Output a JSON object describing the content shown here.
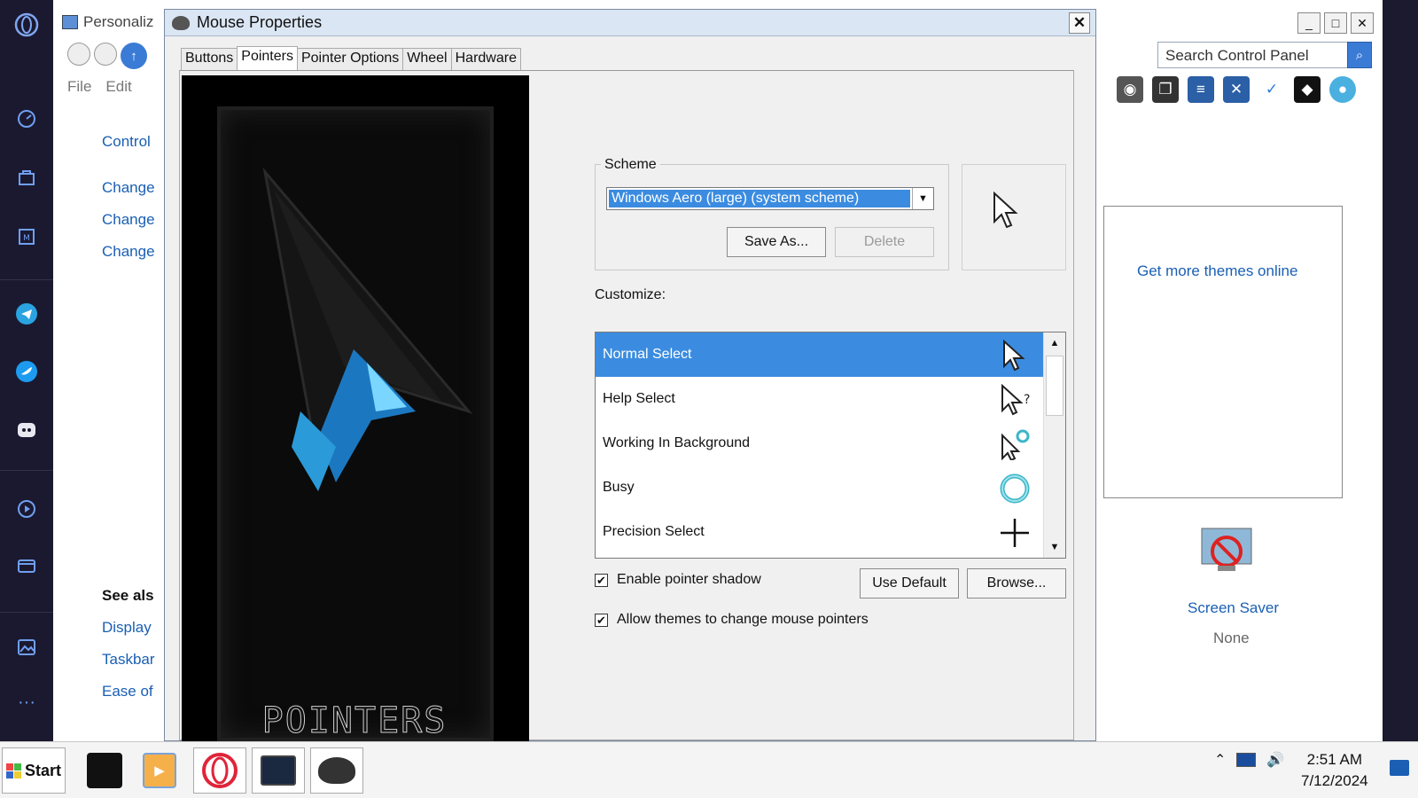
{
  "background_window": {
    "title": "Personaliz",
    "menu": [
      "File",
      "Edit"
    ],
    "left_links": [
      "Control",
      "Change",
      "Change",
      "Change"
    ],
    "see_also_heading": "See als",
    "see_also_links": [
      "Display",
      "Taskbar",
      "Ease of"
    ],
    "search_placeholder": "Search Control Panel",
    "themes_link": "Get more themes online",
    "screensaver_label": "Screen Saver",
    "screensaver_value": "None"
  },
  "dialog": {
    "title": "Mouse Properties",
    "tabs": [
      "Buttons",
      "Pointers",
      "Pointer Options",
      "Wheel",
      "Hardware"
    ],
    "active_tab": "Pointers",
    "art_text": "POINTERS",
    "scheme_label": "Scheme",
    "scheme_value": "Windows Aero (large) (system scheme)",
    "save_as_label": "Save As...",
    "delete_label": "Delete",
    "customize_label": "Customize:",
    "pointer_rows": [
      {
        "label": "Normal Select",
        "icon": "arrow-cursor-icon",
        "selected": true
      },
      {
        "label": "Help Select",
        "icon": "help-cursor-icon",
        "selected": false
      },
      {
        "label": "Working In Background",
        "icon": "working-cursor-icon",
        "selected": false
      },
      {
        "label": "Busy",
        "icon": "busy-cursor-icon",
        "selected": false
      },
      {
        "label": "Precision Select",
        "icon": "crosshair-cursor-icon",
        "selected": false
      }
    ],
    "enable_shadow_label": "Enable pointer shadow",
    "enable_shadow_checked": true,
    "allow_themes_label": "Allow themes to change mouse pointers",
    "allow_themes_checked": true,
    "use_default_label": "Use Default",
    "browse_label": "Browse..."
  },
  "taskbar": {
    "start_label": "Start",
    "time": "2:51 AM",
    "date": "7/12/2024"
  },
  "colors": {
    "accent": "#3b8ce0",
    "link": "#1a5fb4",
    "sidebar": "#1b1930"
  }
}
